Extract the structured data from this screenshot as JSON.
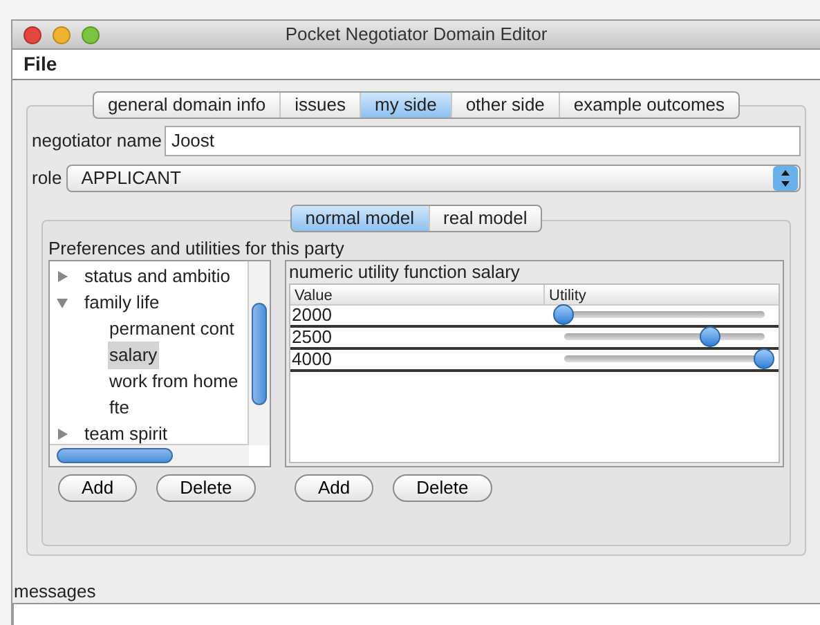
{
  "window": {
    "title": "Pocket Negotiator Domain Editor"
  },
  "menu": [
    "File"
  ],
  "tabs": [
    {
      "label": "general domain info",
      "selected": false
    },
    {
      "label": "issues",
      "selected": false
    },
    {
      "label": "my side",
      "selected": true
    },
    {
      "label": "other side",
      "selected": false
    },
    {
      "label": "example outcomes",
      "selected": false
    }
  ],
  "negotiator_name": {
    "label": "negotiator name",
    "value": "Joost"
  },
  "role": {
    "label": "role",
    "value": "APPLICANT"
  },
  "model_tabs": [
    {
      "label": "normal model",
      "selected": true
    },
    {
      "label": "real model",
      "selected": false
    }
  ],
  "preferences": {
    "title": "Preferences and utilities for this party",
    "tree": [
      {
        "label": "status and ambitio",
        "expanded": false,
        "selected": false
      },
      {
        "label": "family life",
        "expanded": true,
        "selected": false,
        "children": [
          {
            "label": "permanent cont",
            "selected": false
          },
          {
            "label": "salary",
            "selected": true
          },
          {
            "label": "work from home",
            "selected": false
          },
          {
            "label": "fte",
            "selected": false
          }
        ]
      },
      {
        "label": "team spirit",
        "expanded": false,
        "selected": false
      }
    ],
    "buttons": [
      "Add",
      "Delete"
    ]
  },
  "utility": {
    "title": "numeric utility function salary",
    "columns": [
      "Value",
      "Utility"
    ],
    "rows": [
      {
        "value": "2000",
        "level": 0
      },
      {
        "value": "2500",
        "level": 0.73
      },
      {
        "value": "4000",
        "level": 1
      }
    ],
    "buttons": [
      "Add",
      "Delete"
    ]
  },
  "messages": {
    "label": "messages"
  }
}
